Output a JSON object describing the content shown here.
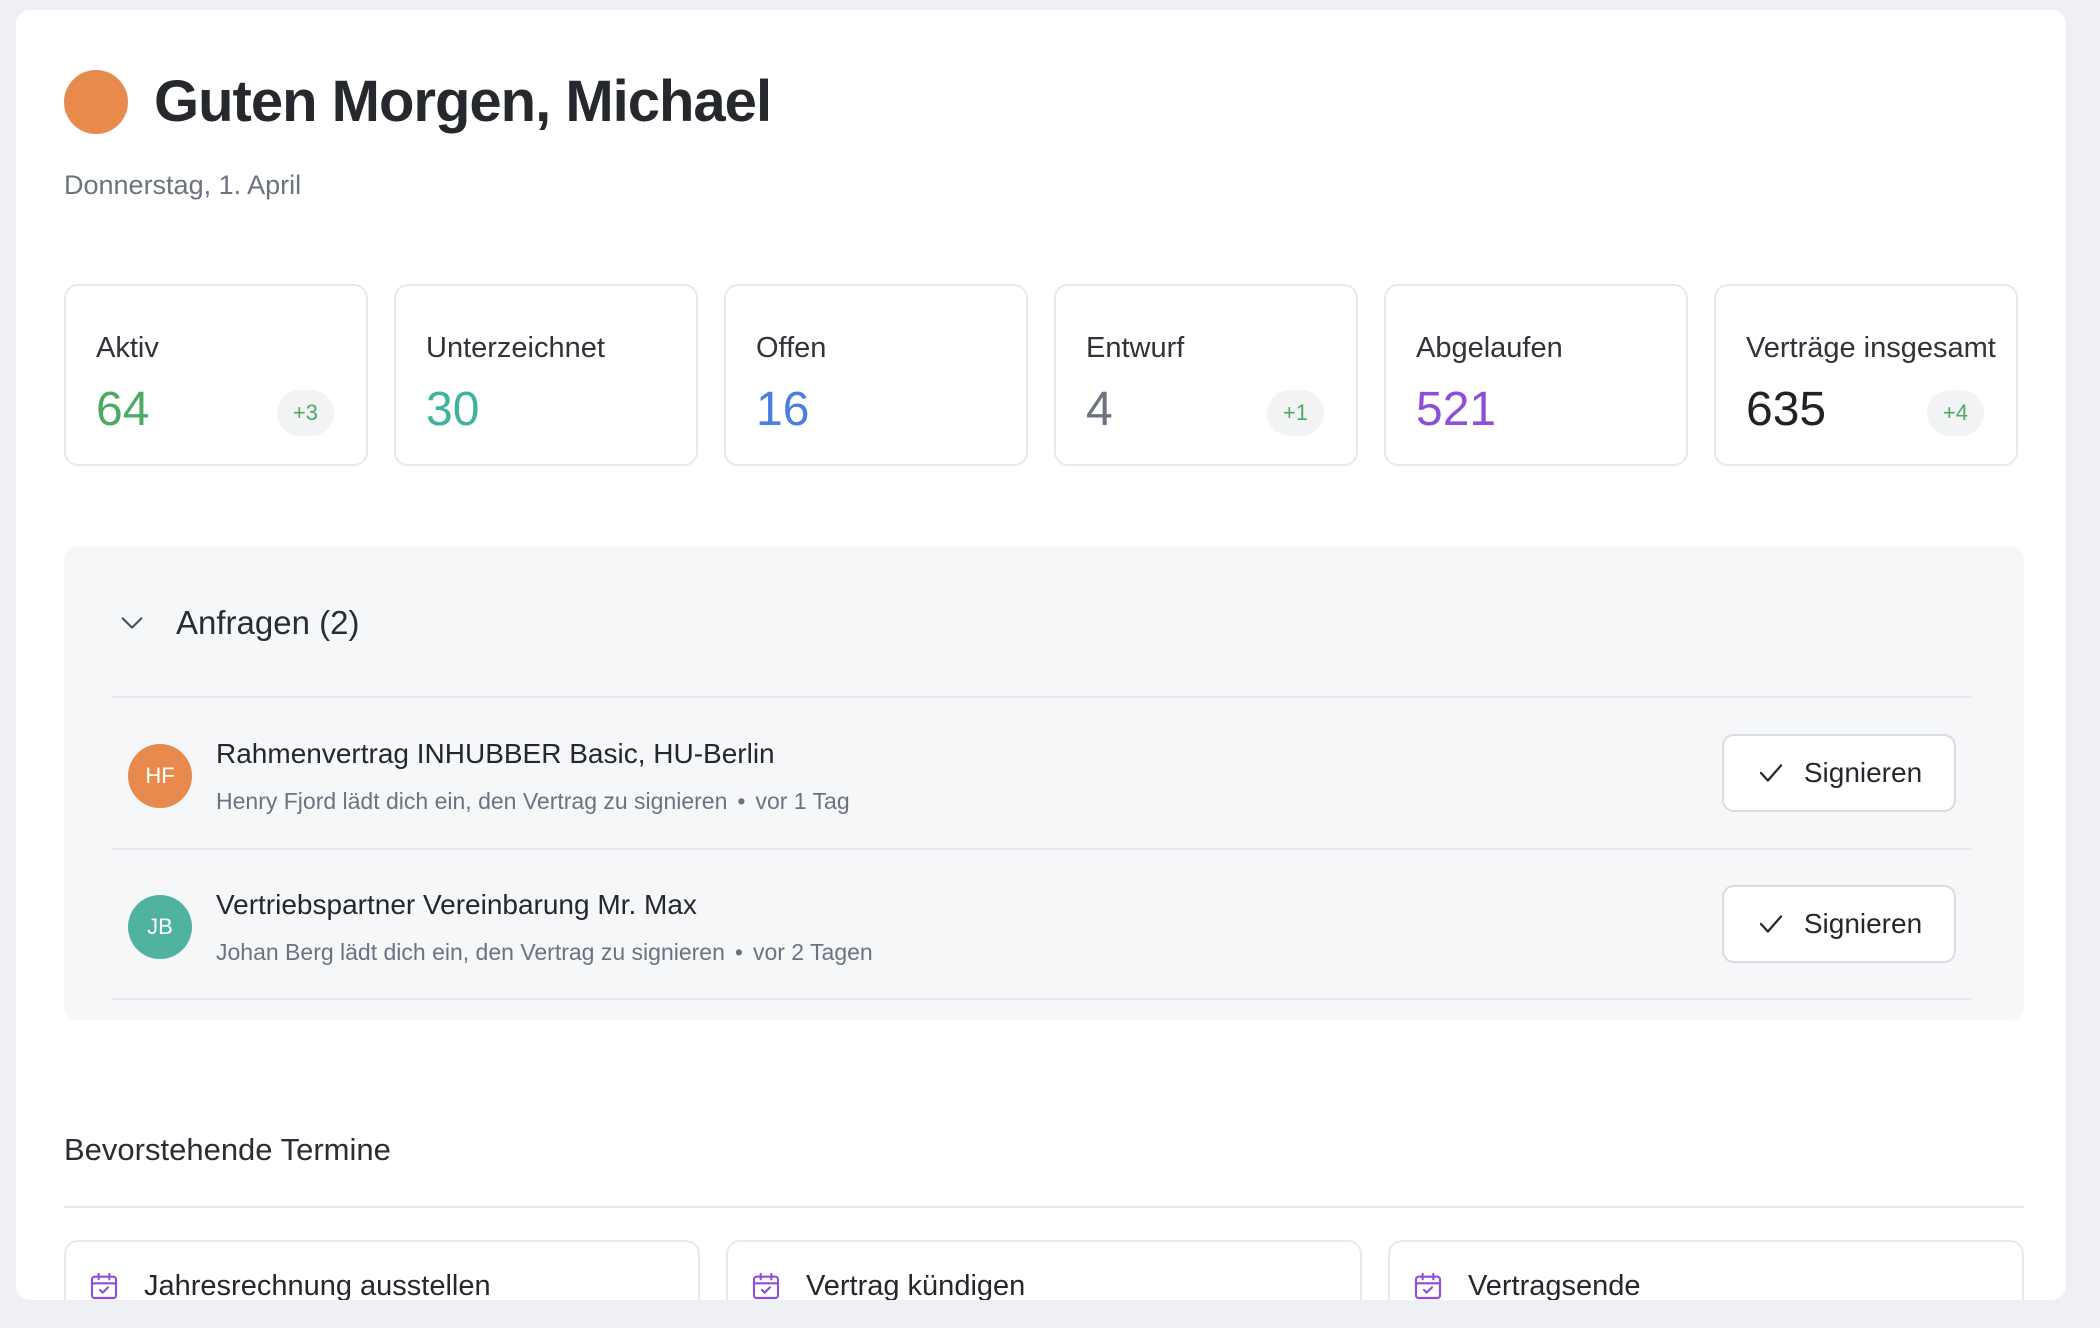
{
  "header": {
    "title": "Guten Morgen, Michael",
    "date": "Donnerstag, 1. April",
    "accent_color": "#e88a4c"
  },
  "stats": [
    {
      "label": "Aktiv",
      "value": "64",
      "badge": "+3",
      "color": "#4caa64"
    },
    {
      "label": "Unterzeichnet",
      "value": "30",
      "badge": "",
      "color": "#3fb3a0"
    },
    {
      "label": "Offen",
      "value": "16",
      "badge": "",
      "color": "#4a7fe0"
    },
    {
      "label": "Entwurf",
      "value": "4",
      "badge": "+1",
      "color": "#6b7280"
    },
    {
      "label": "Abgelaufen",
      "value": "521",
      "badge": "",
      "color": "#8d4fd8"
    },
    {
      "label": "Verträge insgesamt",
      "value": "635",
      "badge": "+4",
      "color": "#1f2328"
    }
  ],
  "requests": {
    "title": "Anfragen (2)",
    "items": [
      {
        "initials": "HF",
        "avatar_color": "#e88a4c",
        "name": "Rahmenvertrag INHUBBER Basic, HU-Berlin",
        "subtitle": "Henry Fjord lädt dich ein, den Vertrag zu signieren",
        "separator": "•",
        "time": "vor 1 Tag",
        "button_label": "Signieren"
      },
      {
        "initials": "JB",
        "avatar_color": "#4fb3a0",
        "name": "Vertriebspartner Vereinbarung Mr. Max",
        "subtitle": "Johan Berg lädt dich ein, den Vertrag zu signieren",
        "separator": "•",
        "time": "vor 2 Tagen",
        "button_label": "Signieren"
      }
    ]
  },
  "upcoming": {
    "title": "Bevorstehende Termine",
    "events": [
      {
        "label": "Jahresrechnung ausstellen",
        "icon": "calendar-check-icon"
      },
      {
        "label": "Vertrag kündigen",
        "icon": "calendar-check-icon"
      },
      {
        "label": "Vertragsende",
        "icon": "calendar-check-icon"
      }
    ],
    "icon_color": "#8d4fd8"
  }
}
